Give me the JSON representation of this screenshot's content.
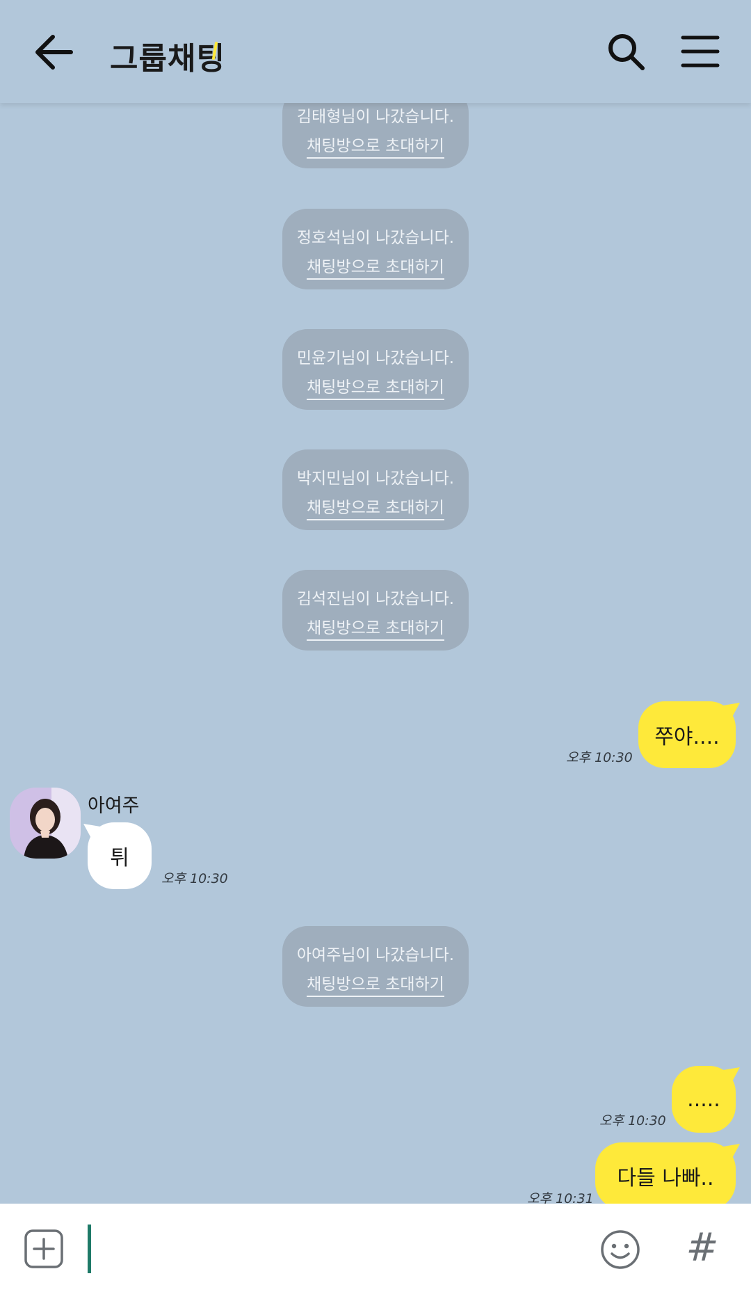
{
  "header": {
    "title": "그룹채팅",
    "accent_color": "#fee93a"
  },
  "system_messages": [
    {
      "left": "김태형님이 나갔습니다.",
      "invite": "채팅방으로 초대하기"
    },
    {
      "left": "정호석님이 나갔습니다.",
      "invite": "채팅방으로 초대하기"
    },
    {
      "left": "민윤기님이 나갔습니다.",
      "invite": "채팅방으로 초대하기"
    },
    {
      "left": "박지민님이 나갔습니다.",
      "invite": "채팅방으로 초대하기"
    },
    {
      "left": "김석진님이 나갔습니다.",
      "invite": "채팅방으로 초대하기"
    },
    {
      "left": "아여주님이 나갔습니다.",
      "invite": "채팅방으로 초대하기"
    }
  ],
  "messages": {
    "m1": {
      "text": "쭈야....",
      "time": "오후 10:30"
    },
    "m2": {
      "sender": "아여주",
      "text": "튀",
      "time": "오후 10:30"
    },
    "m3": {
      "text": ".....",
      "time": "오후 10:30"
    },
    "m4": {
      "text": "다들 나빠..",
      "time": "오후 10:31"
    }
  },
  "input": {
    "placeholder": "",
    "value": ""
  },
  "colors": {
    "background": "#b2c7da",
    "my_bubble": "#fee93a",
    "their_bubble": "#ffffff",
    "system_bubble": "#9faebd"
  }
}
